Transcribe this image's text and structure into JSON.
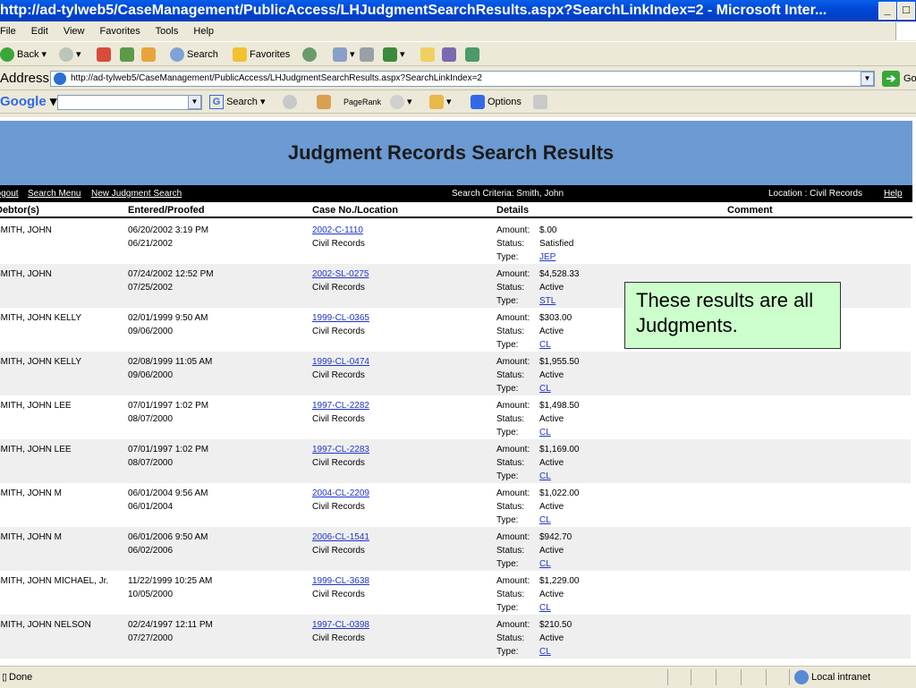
{
  "window": {
    "title": "http://ad-tylweb5/CaseManagement/PublicAccess/LHJudgmentSearchResults.aspx?SearchLinkIndex=2 - Microsoft Inter..."
  },
  "menu": [
    "File",
    "Edit",
    "View",
    "Favorites",
    "Tools",
    "Help"
  ],
  "toolbar": {
    "back": "Back",
    "search": "Search",
    "favorites": "Favorites"
  },
  "address": {
    "label": "Address",
    "url": "http://ad-tylweb5/CaseManagement/PublicAccess/LHJudgmentSearchResults.aspx?SearchLinkIndex=2",
    "go": "Go"
  },
  "googlebar": {
    "logo": "Google",
    "search": "Search",
    "pagerank": "PageRank",
    "options": "Options"
  },
  "page": {
    "title": "Judgment Records Search Results",
    "nav": {
      "logout": "Logout",
      "search_menu": "Search Menu",
      "new_search": "New Judgment Search",
      "criteria": "Search Criteria: Smith, John",
      "location": "Location : Civil Records",
      "help": "Help"
    },
    "columns": {
      "debtor": "Debtor(s)",
      "entered": "Entered/Proofed",
      "case": "Case No./Location",
      "details": "Details",
      "comment": "Comment"
    },
    "detail_labels": {
      "amount": "Amount:",
      "status": "Status:",
      "type": "Type:"
    },
    "rows": [
      {
        "debtor": "SMITH, JOHN",
        "entered": "06/20/2002 3:19 PM",
        "proofed": "06/21/2002",
        "case_no": "2002-C-1110",
        "location": "Civil Records",
        "amount": "$.00",
        "status": "Satisfied",
        "type": "JEP"
      },
      {
        "debtor": "SMITH, JOHN",
        "entered": "07/24/2002 12:52 PM",
        "proofed": "07/25/2002",
        "case_no": "2002-SL-0275",
        "location": "Civil Records",
        "amount": "$4,528.33",
        "status": "Active",
        "type": "STL"
      },
      {
        "debtor": "SMITH, JOHN KELLY",
        "entered": "02/01/1999 9:50 AM",
        "proofed": "09/06/2000",
        "case_no": "1999-CL-0365",
        "location": "Civil Records",
        "amount": "$303.00",
        "status": "Active",
        "type": "CL"
      },
      {
        "debtor": "SMITH, JOHN KELLY",
        "entered": "02/08/1999 11:05 AM",
        "proofed": "09/06/2000",
        "case_no": "1999-CL-0474",
        "location": "Civil Records",
        "amount": "$1,955.50",
        "status": "Active",
        "type": "CL"
      },
      {
        "debtor": "SMITH, JOHN LEE",
        "entered": "07/01/1997 1:02 PM",
        "proofed": "08/07/2000",
        "case_no": "1997-CL-2282",
        "location": "Civil Records",
        "amount": "$1,498.50",
        "status": "Active",
        "type": "CL"
      },
      {
        "debtor": "SMITH, JOHN LEE",
        "entered": "07/01/1997 1:02 PM",
        "proofed": "08/07/2000",
        "case_no": "1997-CL-2283",
        "location": "Civil Records",
        "amount": "$1,169.00",
        "status": "Active",
        "type": "CL"
      },
      {
        "debtor": "SMITH, JOHN M",
        "entered": "06/01/2004 9:56 AM",
        "proofed": "06/01/2004",
        "case_no": "2004-CL-2209",
        "location": "Civil Records",
        "amount": "$1,022.00",
        "status": "Active",
        "type": "CL"
      },
      {
        "debtor": "SMITH, JOHN M",
        "entered": "06/01/2006 9:50 AM",
        "proofed": "06/02/2006",
        "case_no": "2006-CL-1541",
        "location": "Civil Records",
        "amount": "$942.70",
        "status": "Active",
        "type": "CL"
      },
      {
        "debtor": "SMITH, JOHN MICHAEL, Jr.",
        "entered": "11/22/1999 10:25 AM",
        "proofed": "10/05/2000",
        "case_no": "1999-CL-3638",
        "location": "Civil Records",
        "amount": "$1,229.00",
        "status": "Active",
        "type": "CL"
      },
      {
        "debtor": "SMITH, JOHN NELSON",
        "entered": "02/24/1997 12:11 PM",
        "proofed": "07/27/2000",
        "case_no": "1997-CL-0398",
        "location": "Civil Records",
        "amount": "$210.50",
        "status": "Active",
        "type": "CL"
      }
    ]
  },
  "callout": "These results are all Judgments.",
  "status": {
    "text": "Done",
    "zone": "Local intranet"
  },
  "colors": {
    "banner": "#6c9ad2",
    "callout_bg": "#ccffcc",
    "link": "#1f35c8"
  }
}
